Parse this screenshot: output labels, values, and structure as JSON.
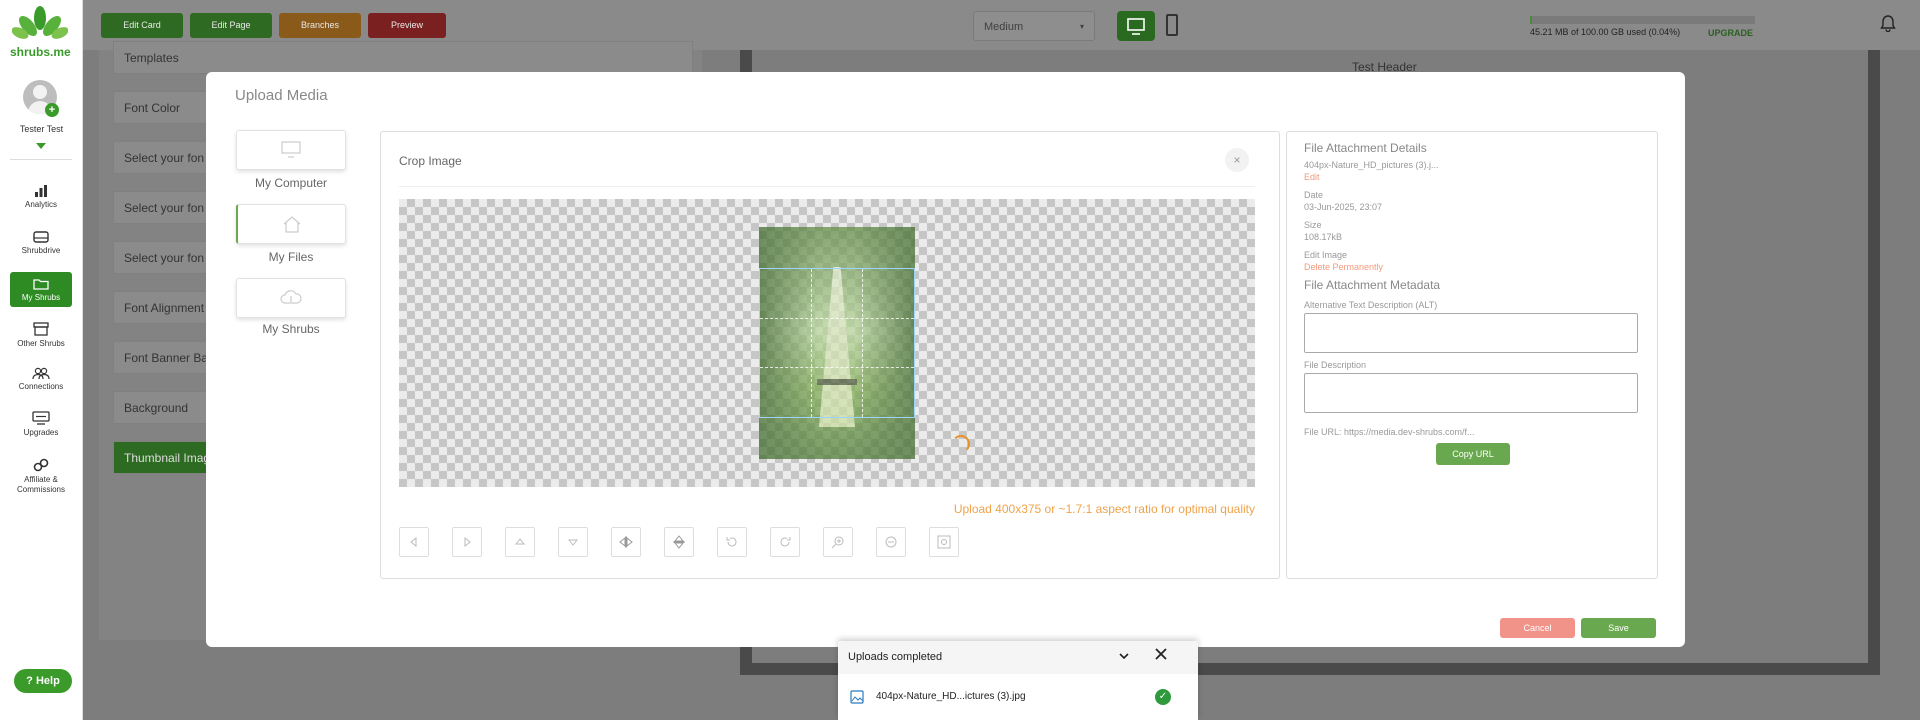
{
  "brand": {
    "name": "shrubs.me",
    "color": "#3a9a2a"
  },
  "user": {
    "name": "Tester Test"
  },
  "sidebar": {
    "items": [
      {
        "label": "Analytics",
        "icon": "bar-chart-icon"
      },
      {
        "label": "Shrubdrive",
        "icon": "drive-icon"
      },
      {
        "label": "My Shrubs",
        "icon": "folder-icon",
        "active": true
      },
      {
        "label": "Other Shrubs",
        "icon": "archive-icon"
      },
      {
        "label": "Connections",
        "icon": "users-icon"
      },
      {
        "label": "Upgrades",
        "icon": "upgrade-icon"
      },
      {
        "label": "Affiliate & Commissions",
        "icon": "link-icon"
      }
    ],
    "help_label": "Help"
  },
  "topbar": {
    "buttons": [
      "Edit Card",
      "Edit Page",
      "Branches",
      "Preview"
    ],
    "size_select": "Medium",
    "storage_text": "45.21 MB of 100.00 GB used (0.04%)",
    "storage_fraction": 0.0004,
    "upgrade_label": "UPGRADE"
  },
  "background": {
    "rows": [
      "Templates",
      "Font Color",
      "Select your fon",
      "Select your fon",
      "Select your fon",
      "Font Alignment",
      "Font Banner Ba",
      "Background",
      "Thumbnail Imag"
    ],
    "right_header": "Test Header"
  },
  "modal": {
    "title": "Upload Media",
    "sources": [
      "My Computer",
      "My Files",
      "My Shrubs"
    ],
    "crop": {
      "title": "Crop Image",
      "close": "×",
      "hint": "Upload 400x375 or ~1.7:1 aspect ratio for optimal quality",
      "tools": [
        "move-left-icon",
        "move-right-icon",
        "move-up-icon",
        "move-down-icon",
        "flip-horizontal-icon",
        "flip-vertical-icon",
        "rotate-left-icon",
        "rotate-right-icon",
        "zoom-in-icon",
        "zoom-out-icon",
        "reset-icon"
      ]
    },
    "details": {
      "heading": "File Attachment Details",
      "file_name": "404px-Nature_HD_pictures (3).j...",
      "edit_link": "Edit",
      "date_label": "Date",
      "date_value": "03-Jun-2025, 23:07",
      "size_label": "Size",
      "size_value": "108.17kB",
      "edit_image_label": "Edit Image",
      "delete_link": "Delete Permanently",
      "meta_heading": "File Attachment Metadata",
      "alt_label": "Alternative Text Description (ALT)",
      "desc_label": "File Description",
      "url_text": "File URL: https://media.dev-shrubs.com/f...",
      "copy_label": "Copy URL"
    },
    "cancel_label": "Cancel",
    "save_label": "Save"
  },
  "toast": {
    "title": "Uploads completed",
    "file": "404px-Nature_HD...ictures (3).jpg"
  }
}
